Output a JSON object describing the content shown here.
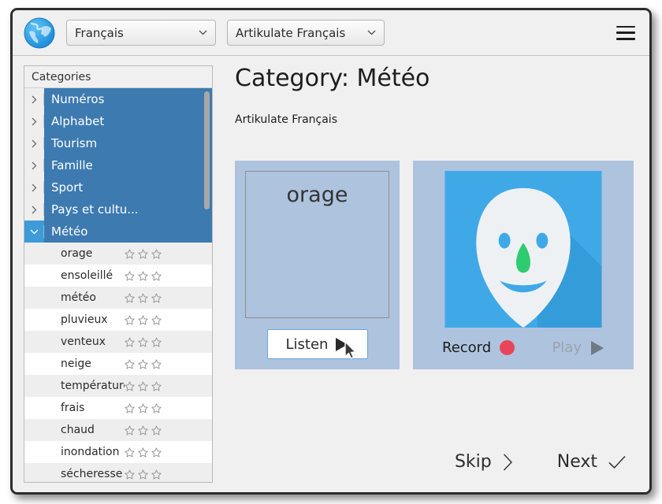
{
  "header": {
    "globe_icon": "globe-icon",
    "language_select": {
      "value": "Français",
      "placeholder": "Français"
    },
    "course_select": {
      "value": "Artikulate Français",
      "placeholder": "Artikulate Français"
    },
    "menu_icon": "hamburger-menu-icon"
  },
  "sidebar": {
    "header_label": "Categories",
    "categories": [
      {
        "label": "Numéros",
        "expanded": false
      },
      {
        "label": "Alphabet",
        "expanded": false
      },
      {
        "label": "Tourism",
        "expanded": false
      },
      {
        "label": "Famille",
        "expanded": false
      },
      {
        "label": "Sport",
        "expanded": false
      },
      {
        "label": "Pays et cultu...",
        "expanded": false
      },
      {
        "label": "Météo",
        "expanded": true
      }
    ],
    "words": [
      {
        "label": "orage",
        "stars": 3
      },
      {
        "label": "ensoleillé",
        "stars": 3
      },
      {
        "label": "météo",
        "stars": 3
      },
      {
        "label": "pluvieux",
        "stars": 3
      },
      {
        "label": "venteux",
        "stars": 3
      },
      {
        "label": "neige",
        "stars": 3
      },
      {
        "label": "température",
        "stars": 3
      },
      {
        "label": "frais",
        "stars": 3
      },
      {
        "label": "chaud",
        "stars": 3
      },
      {
        "label": "inondation",
        "stars": 3
      },
      {
        "label": "sécheresse",
        "stars": 3
      }
    ]
  },
  "main": {
    "title": "Category: Météo",
    "subtitle": "Artikulate Français",
    "word_card": {
      "word": "orage",
      "listen_label": "Listen",
      "listen_icon": "play-triangle-icon",
      "cursor_icon": "mouse-pointer-icon"
    },
    "record_card": {
      "avatar_icon": "user-face-avatar-icon",
      "record_label": "Record",
      "record_icon": "record-dot-icon",
      "play_label": "Play",
      "play_icon": "play-triangle-icon"
    },
    "footer": {
      "skip_label": "Skip",
      "skip_icon": "chevron-right-icon",
      "next_label": "Next",
      "next_icon": "check-icon"
    }
  },
  "colors": {
    "selection_blue": "#3d7ab0",
    "expanded_blue": "#3f9ad8",
    "card_blue": "#aec3de",
    "avatar_bg_blue": "#3fa9e8",
    "record_red": "#e8455a",
    "nose_green": "#2ecb71",
    "window_border": "#2c2c2c"
  }
}
